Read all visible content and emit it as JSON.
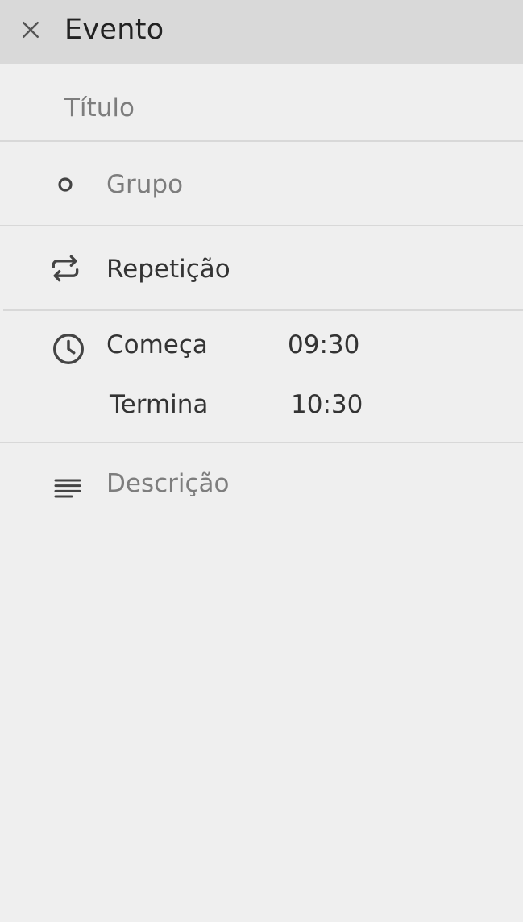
{
  "header": {
    "close_icon": "close-icon",
    "title": "Evento"
  },
  "form": {
    "title_placeholder": "Título",
    "group": {
      "icon": "circle-icon",
      "label": "Grupo"
    },
    "repeat": {
      "icon": "repeat-icon",
      "label": "Repetição"
    },
    "time": {
      "icon": "clock-icon",
      "start_label": "Começa",
      "start_value": "09:30",
      "end_label": "Termina",
      "end_value": "10:30"
    },
    "description": {
      "icon": "notes-icon",
      "placeholder": "Descrição"
    }
  },
  "colors": {
    "header_bg": "#d9d9d9",
    "background": "#efefef",
    "divider": "#d8d8d8",
    "text": "#333333",
    "placeholder": "#7d7d7d"
  }
}
